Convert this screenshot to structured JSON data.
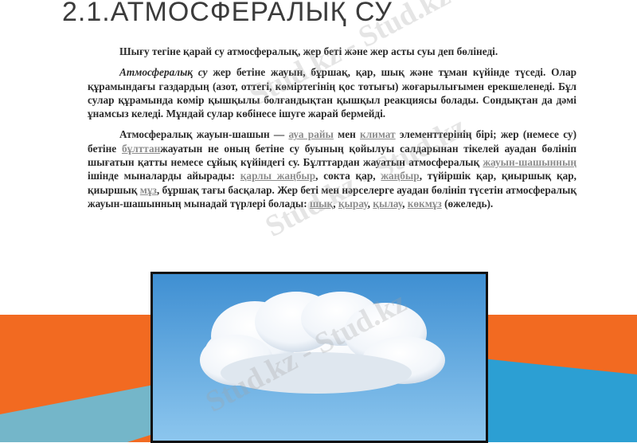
{
  "title": "2.1.АТМОСФЕРАЛЫҚ СУ",
  "p1": "Шығу тегіне қарай су атмосфералық, жер беті және жер асты суы деп бөлінеді.",
  "p2": {
    "t1": "Атмосфералық су",
    "t2": " жер бетіне жауын, бұршақ, қар, шық және тұман күйінде түседі. Олар құрамындағы газдардың (азот, оттегі, көміртегінің қос тотығы) жоғарылығымен ерекшеленеді. Бұл сулар құрамында көмір қышқылы болғандықтан қышқыл реакциясы болады. Сондықтан да дәмі ұнамсыз келеді. Мұндай сулар көбінесе ішуге жарай бермейді."
  },
  "p3": {
    "t1": "Атмосфералық жауын-шашын — ",
    "l1": "ауа райы",
    "t2": " мен ",
    "l2": "климат",
    "t3": " элементтерінің бірі; жер (немесе су) бетіне ",
    "l3": "бұлттан",
    "t4": "жауатын не оның бетіне су буының қойылуы салдарынан тікелей ауадан бөлініп шығатын қатты немесе сұйық күйіндегі су. Бұлттардан жауатын атмосфералық ",
    "l4": "жауын-шашынның",
    "t5": " ішінде мыналарды айырады: ",
    "l5": "қарлы жаңбыр",
    "t6": ", сокта қар, ",
    "l6": "жаңбыр",
    "t7": ", түйіршік қар, қиыршық қар, қиыршық ",
    "l7": "мұз",
    "t8": ", бұршақ тағы басқалар. Жер беті мен нәрселерге ауадан бөлініп түсетін атмосфералық жауын-шашынның мынадай түрлері болады: ",
    "l8": "шық",
    "t9": ", ",
    "l9": "қырау",
    "t10": ", ",
    "l10": "қылау",
    "t11": ", ",
    "l11": "көкмұз",
    "t12": " (өжеледь)."
  },
  "watermark": "Stud.kz - Stud.kz",
  "colors": {
    "orange": "#f26a21",
    "blue": "#2c9fd3",
    "link": "#8c8c8c",
    "sky": "#5aa6df"
  }
}
